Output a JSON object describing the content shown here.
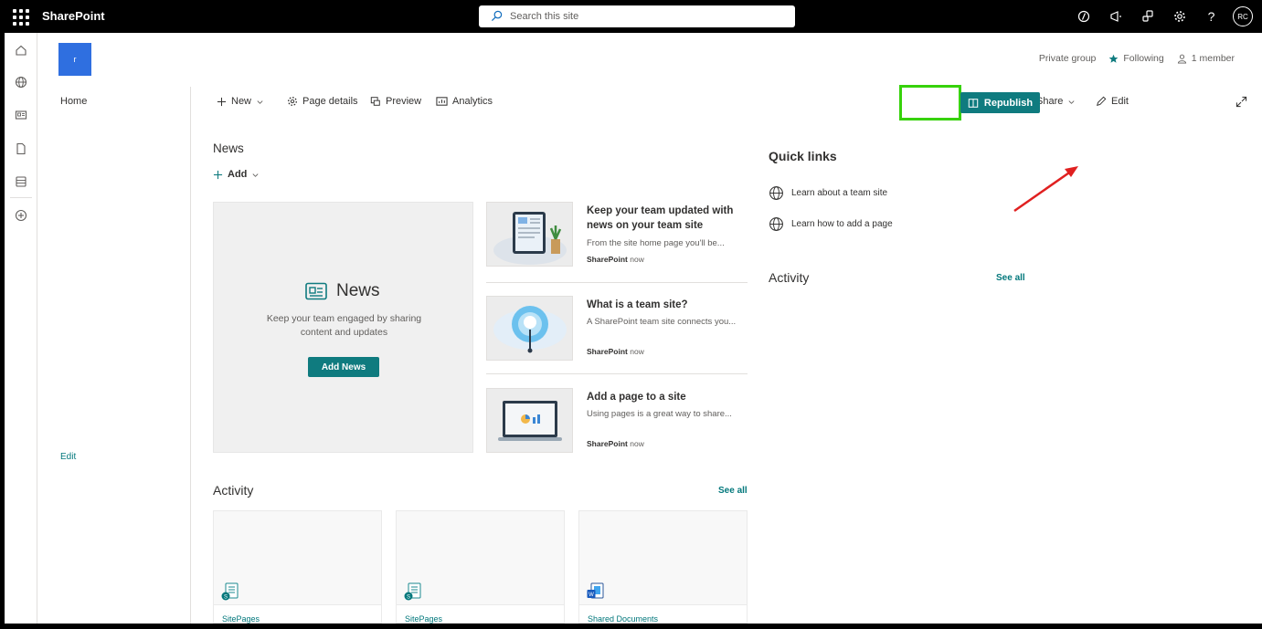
{
  "topbar": {
    "app_name": "SharePoint",
    "search_placeholder": "Search this site",
    "avatar_initials": "RC"
  },
  "site": {
    "logo_letter": "r",
    "privacy": "Private group",
    "following_label": "Following",
    "members_label": "1 member"
  },
  "leftnav": {
    "home_label": "Home",
    "edit_label": "Edit"
  },
  "commandbar": {
    "new_label": "New",
    "page_details_label": "Page details",
    "preview_label": "Preview",
    "analytics_label": "Analytics",
    "share_label": "Share",
    "edit_label": "Edit",
    "republish_label": "Republish"
  },
  "news": {
    "title": "News",
    "add_label": "Add",
    "hero_title": "News",
    "hero_text": "Keep your team engaged by sharing content and updates",
    "hero_button": "Add News",
    "items": [
      {
        "title": "Keep your team updated with news on your team site",
        "desc": "From the site home page you'll be...",
        "source": "SharePoint",
        "time": "now"
      },
      {
        "title": "What is a team site?",
        "desc": "A SharePoint team site connects you...",
        "source": "SharePoint",
        "time": "now"
      },
      {
        "title": "Add a page to a site",
        "desc": "Using pages is a great way to share...",
        "source": "SharePoint",
        "time": "now"
      }
    ]
  },
  "activity": {
    "title": "Activity",
    "see_all": "See all",
    "cards": [
      {
        "label": "SitePages"
      },
      {
        "label": "SitePages"
      },
      {
        "label": "Shared Documents"
      }
    ]
  },
  "quick_links": {
    "title": "Quick links",
    "items": [
      {
        "label": "Learn about a team site"
      },
      {
        "label": "Learn how to add a page"
      }
    ]
  },
  "side_activity": {
    "title": "Activity",
    "see_all": "See all"
  },
  "colors": {
    "accent": "#0f7b7f",
    "highlight": "#37d20b",
    "arrow": "#e02020"
  }
}
